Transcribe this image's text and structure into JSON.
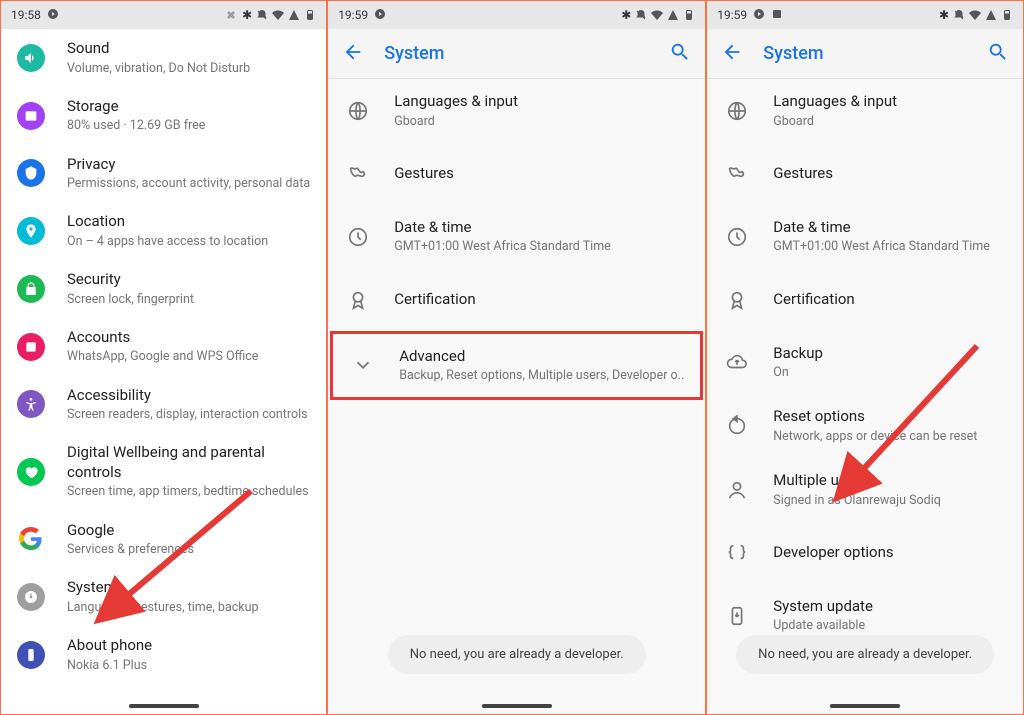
{
  "statusbar": {
    "time1": "19:58",
    "time2": "19:59",
    "time3": "19:59"
  },
  "screen1": {
    "items": [
      {
        "title": "Sound",
        "sub": "Volume, vibration, Do Not Disturb"
      },
      {
        "title": "Storage",
        "sub": "80% used · 12.69 GB free"
      },
      {
        "title": "Privacy",
        "sub": "Permissions, account activity, personal data"
      },
      {
        "title": "Location",
        "sub": "On – 4 apps have access to location"
      },
      {
        "title": "Security",
        "sub": "Screen lock, fingerprint"
      },
      {
        "title": "Accounts",
        "sub": "WhatsApp, Google and WPS Office"
      },
      {
        "title": "Accessibility",
        "sub": "Screen readers, display, interaction controls"
      },
      {
        "title": "Digital Wellbeing and parental controls",
        "sub": "Screen time, app timers, bedtime schedules"
      },
      {
        "title": "Google",
        "sub": "Services & preferences"
      },
      {
        "title": "System",
        "sub": "Languages, gestures, time, backup"
      },
      {
        "title": "About phone",
        "sub": "Nokia 6.1 Plus"
      }
    ]
  },
  "screen2": {
    "header": "System",
    "items": [
      {
        "title": "Languages & input",
        "sub": "Gboard"
      },
      {
        "title": "Gestures",
        "sub": ""
      },
      {
        "title": "Date & time",
        "sub": "GMT+01:00 West Africa Standard Time"
      },
      {
        "title": "Certification",
        "sub": ""
      },
      {
        "title": "Advanced",
        "sub": "Backup, Reset options, Multiple users, Developer o.."
      }
    ],
    "toast": "No need, you are already a developer."
  },
  "screen3": {
    "header": "System",
    "items": [
      {
        "title": "Languages & input",
        "sub": "Gboard"
      },
      {
        "title": "Gestures",
        "sub": ""
      },
      {
        "title": "Date & time",
        "sub": "GMT+01:00 West Africa Standard Time"
      },
      {
        "title": "Certification",
        "sub": ""
      },
      {
        "title": "Backup",
        "sub": "On"
      },
      {
        "title": "Reset options",
        "sub": "Network, apps or device can be reset"
      },
      {
        "title": "Multiple users",
        "sub": "Signed in as Olanrewaju Sodiq"
      },
      {
        "title": "Developer options",
        "sub": ""
      },
      {
        "title": "System update",
        "sub": "Update available"
      }
    ],
    "toast": "No need, you are already a developer."
  }
}
